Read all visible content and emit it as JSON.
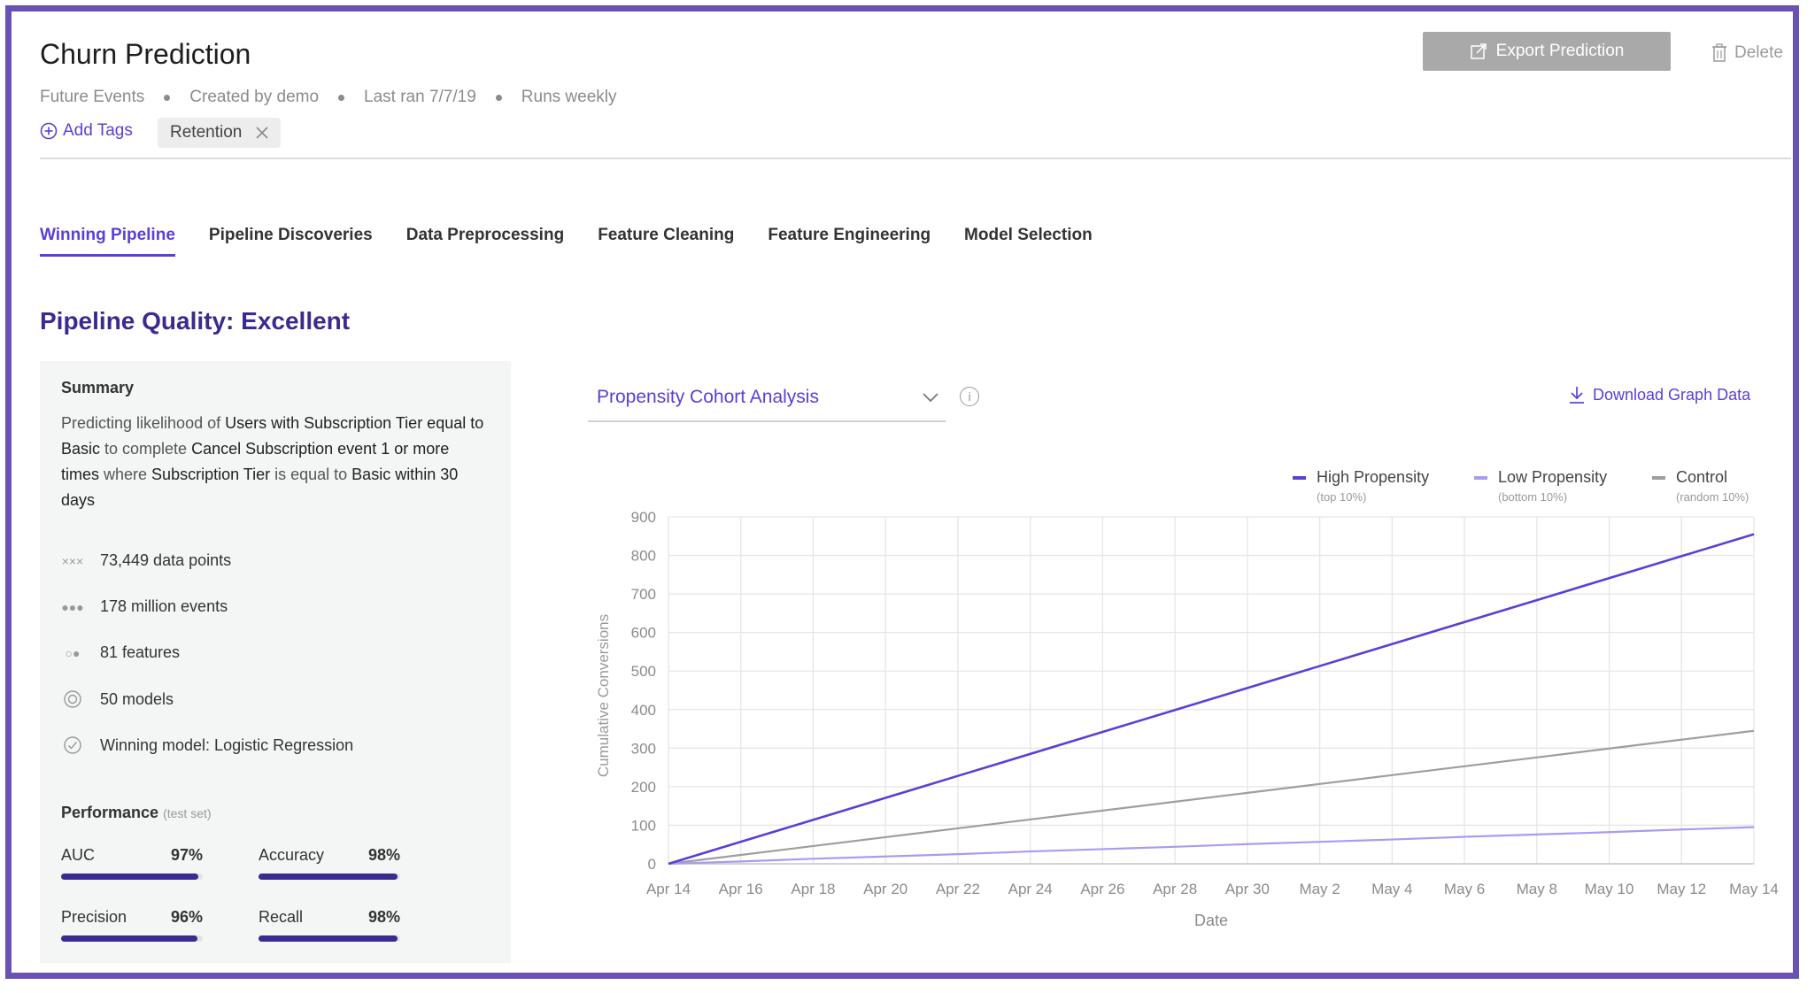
{
  "header": {
    "title": "Churn Prediction",
    "meta": [
      "Future Events",
      "Created by demo",
      "Last ran 7/7/19",
      "Runs weekly"
    ],
    "add_tags_label": "Add Tags",
    "tag_label": "Retention",
    "export_label": "Export Prediction",
    "delete_label": "Delete"
  },
  "tabs": [
    {
      "label": "Winning Pipeline",
      "active": true
    },
    {
      "label": "Pipeline Discoveries"
    },
    {
      "label": "Data Preprocessing"
    },
    {
      "label": "Feature Cleaning"
    },
    {
      "label": "Feature Engineering"
    },
    {
      "label": "Model Selection"
    }
  ],
  "quality_title": "Pipeline Quality: Excellent",
  "summary": {
    "heading": "Summary",
    "desc_parts": [
      {
        "text": "Predicting likelihood of ",
        "hl": false
      },
      {
        "text": "Users with Subscription Tier equal to Basic",
        "hl": true
      },
      {
        "text": " to complete ",
        "hl": false
      },
      {
        "text": "Cancel Subscription event 1 or more times",
        "hl": true
      },
      {
        "text": " where ",
        "hl": false
      },
      {
        "text": "Subscription Tier",
        "hl": true
      },
      {
        "text": " is equal to ",
        "hl": false
      },
      {
        "text": "Basic within 30 days",
        "hl": true
      }
    ],
    "stats": [
      {
        "icon": "data-points-icon",
        "text": "73,449 data points"
      },
      {
        "icon": "events-icon",
        "text": "178 million events"
      },
      {
        "icon": "features-icon",
        "text": "81 features"
      },
      {
        "icon": "models-icon",
        "text": "50 models"
      },
      {
        "icon": "check-circle-icon",
        "text": "Winning model: Logistic Regression"
      }
    ],
    "performance_label": "Performance",
    "performance_sub": "(test set)",
    "metrics": [
      {
        "name": "AUC",
        "value": "97%",
        "fraction": 0.97
      },
      {
        "name": "Accuracy",
        "value": "98%",
        "fraction": 0.98
      },
      {
        "name": "Precision",
        "value": "96%",
        "fraction": 0.96
      },
      {
        "name": "Recall",
        "value": "98%",
        "fraction": 0.98
      }
    ]
  },
  "analysis": {
    "dropdown_label": "Propensity Cohort Analysis",
    "download_label": "Download Graph Data"
  },
  "colors": {
    "accent": "#5b3fd6",
    "dark": "#3b2a8f",
    "high": "#5b3fd6",
    "low": "#a99bf2",
    "control": "#9e9e9e"
  },
  "chart_data": {
    "type": "line",
    "xlabel": "Date",
    "ylabel": "Cumulative Conversions",
    "x": [
      "Apr 14",
      "Apr 16",
      "Apr 18",
      "Apr 20",
      "Apr 22",
      "Apr 24",
      "Apr 26",
      "Apr 28",
      "Apr 30",
      "May 2",
      "May 4",
      "May 6",
      "May 8",
      "May 10",
      "May 12",
      "May 14"
    ],
    "ylim": [
      0,
      900
    ],
    "yticks": [
      0,
      100,
      200,
      300,
      400,
      500,
      600,
      700,
      800,
      900
    ],
    "grid": true,
    "legend_position": "top-right",
    "series": [
      {
        "name": "High Propensity",
        "sub": "(top 10%)",
        "color": "#5b3fd6",
        "values": [
          0,
          57,
          114,
          171,
          228,
          285,
          342,
          399,
          456,
          513,
          570,
          627,
          684,
          741,
          798,
          855
        ]
      },
      {
        "name": "Low Propensity",
        "sub": "(bottom 10%)",
        "color": "#a99bf2",
        "values": [
          0,
          6,
          13,
          19,
          25,
          32,
          38,
          44,
          51,
          57,
          63,
          70,
          76,
          82,
          89,
          95
        ]
      },
      {
        "name": "Control",
        "sub": "(random 10%)",
        "color": "#9e9e9e",
        "values": [
          0,
          23,
          46,
          69,
          92,
          115,
          138,
          161,
          184,
          207,
          230,
          253,
          276,
          299,
          322,
          345
        ]
      }
    ]
  }
}
